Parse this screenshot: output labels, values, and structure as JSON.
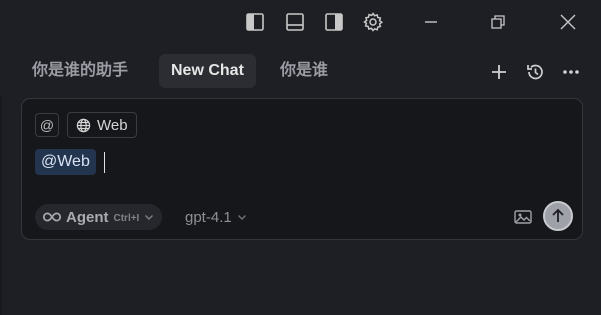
{
  "titlebar": {
    "icons": [
      "toggle-primary-sidebar-icon",
      "toggle-panel-icon",
      "toggle-secondary-sidebar-icon",
      "gear-icon",
      "minimize-icon",
      "restore-icon",
      "close-icon"
    ]
  },
  "tabs": [
    {
      "label": "你是谁的助手",
      "active": false
    },
    {
      "label": "New Chat",
      "active": true
    },
    {
      "label": "你是谁",
      "active": false
    }
  ],
  "tab_actions": [
    "plus-icon",
    "history-icon",
    "more-icon"
  ],
  "composer": {
    "at_chip": "@",
    "web_chip": "Web",
    "mention": "@Web",
    "mode": {
      "label": "Agent",
      "shortcut": "Ctrl+I"
    },
    "model": "gpt-4.1"
  },
  "colors": {
    "background": "#1e1f25",
    "composer_bg": "#16171b",
    "mention_bg": "#23344e",
    "send_button": "#9fa1a8"
  }
}
